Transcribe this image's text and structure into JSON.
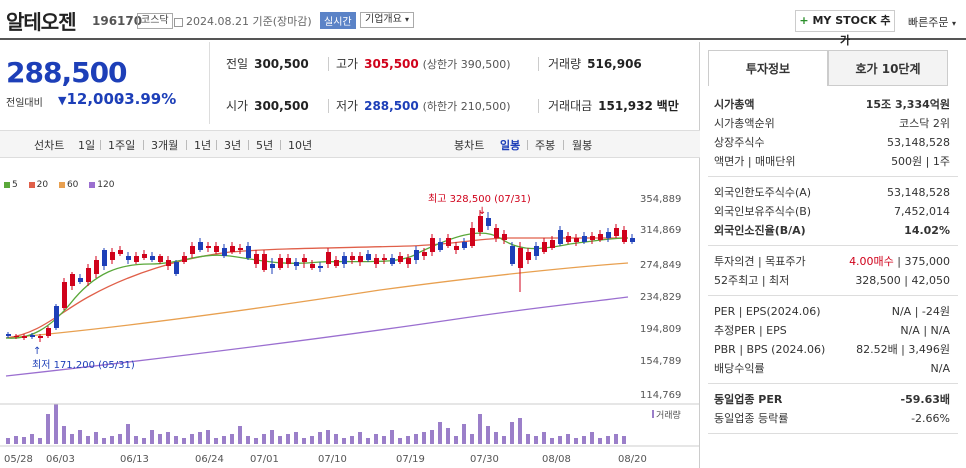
{
  "header": {
    "name": "알테오젠",
    "code": "196170",
    "market": "코스닥",
    "date_text": "2024.08.21 기준(장마감)",
    "live": "실시간",
    "corp_info": "기업개요",
    "mystock": "MY STOCK 추가",
    "quick_order": "빠른주문"
  },
  "price": {
    "current": "288,500",
    "change_label": "전일대비",
    "change": "12,000",
    "change_pct": "-3.99%"
  },
  "quote": {
    "prev_label": "전일",
    "prev": "300,500",
    "high_label": "고가",
    "high": "305,500",
    "upper_limit": "(상한가 390,500)",
    "volume_label": "거래량",
    "volume": "516,906",
    "open_label": "시가",
    "open": "300,500",
    "low_label": "저가",
    "low": "288,500",
    "lower_limit": "(하한가 210,500)",
    "amount_label": "거래대금",
    "amount": "151,932",
    "amount_unit": "백만"
  },
  "periods": {
    "line_chart": "선차트",
    "items": [
      "1일",
      "1주일",
      "3개월",
      "1년",
      "3년",
      "5년",
      "10년"
    ],
    "candle_chart": "봉차트",
    "candle_items": [
      "일봉",
      "주봉",
      "월봉"
    ]
  },
  "legend": [
    {
      "label": "5",
      "color": "#5aa83a"
    },
    {
      "label": "20",
      "color": "#e0604a"
    },
    {
      "label": "60",
      "color": "#e8a050"
    },
    {
      "label": "120",
      "color": "#9b6fd0"
    }
  ],
  "chart_data": {
    "type": "candlestick",
    "y_ticks": [
      "354,889",
      "314,869",
      "274,849",
      "234,829",
      "194,809",
      "154,789",
      "114,769"
    ],
    "x_ticks": [
      "05/28",
      "06/03",
      "06/13",
      "06/24",
      "07/01",
      "07/10",
      "07/19",
      "07/30",
      "08/08",
      "08/20"
    ],
    "high_annotation": "최고 328,500 (07/31)",
    "low_annotation": "최저 171,200 (05/31)",
    "volume_label": "거래량",
    "colors": {
      "up": "#d0021b",
      "down": "#1d3fb8",
      "volume": "#9b7fc9"
    },
    "y_range": [
      114769,
      354889
    ]
  },
  "tabs": [
    "투자정보",
    "호가 10단계"
  ],
  "info": [
    {
      "k": "시가총액",
      "v": "15조 3,334억원",
      "bold": true
    },
    {
      "k": "시가총액순위",
      "v": "코스닥 2위"
    },
    {
      "k": "상장주식수",
      "v": "53,148,528"
    },
    {
      "k": "액면가 | 매매단위",
      "v": "500원 | 1주"
    }
  ],
  "info2": [
    {
      "k": "외국인한도주식수(A)",
      "v": "53,148,528"
    },
    {
      "k": "외국인보유주식수(B)",
      "v": "7,452,014"
    },
    {
      "k": "외국인소진율(B/A)",
      "v": "14.02%",
      "bold": true
    }
  ],
  "info3": [
    {
      "k": "투자의견 | 목표주가",
      "v_red": "4.00매수",
      "v": "375,000"
    },
    {
      "k": "52주최고 | 최저",
      "v": "328,500 | 42,050"
    }
  ],
  "info4": [
    {
      "k": "PER | EPS(2024.06)",
      "v": "N/A | -24원"
    },
    {
      "k": "추정PER | EPS",
      "v": "N/A | N/A"
    },
    {
      "k": "PBR | BPS (2024.06)",
      "v": "82.52배 | 3,496원"
    },
    {
      "k": "배당수익률",
      "v": "N/A"
    }
  ],
  "info5": [
    {
      "k": "동일업종 PER",
      "v": "-59.63배",
      "bold": true
    },
    {
      "k": "동일업종 등락률",
      "v": "-2.66%"
    }
  ]
}
